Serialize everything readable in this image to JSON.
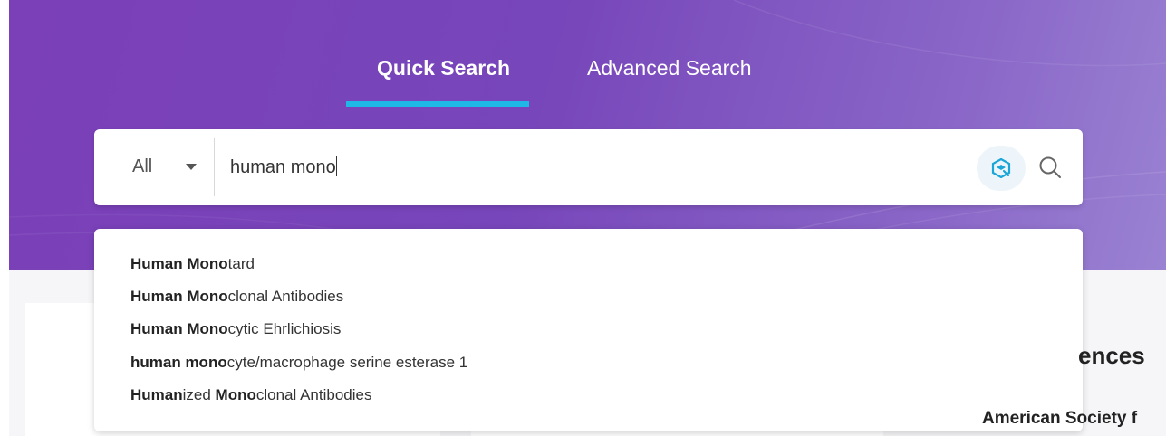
{
  "tabs": [
    {
      "label": "Quick Search",
      "active": true
    },
    {
      "label": "Advanced Search",
      "active": false
    }
  ],
  "search": {
    "scope": "All",
    "query": "human mono"
  },
  "suggestions": [
    {
      "bold": "Human Mono",
      "rest": "tard"
    },
    {
      "bold": "Human Mono",
      "rest": "clonal Antibodies"
    },
    {
      "bold": "Human Mono",
      "rest": "cytic Ehrlichiosis"
    },
    {
      "bold": "human mono",
      "rest": "cyte/macrophage serine esterase 1"
    },
    {
      "parts": [
        {
          "b": "Human"
        },
        {
          "t": "ized "
        },
        {
          "b": "Mono"
        },
        {
          "t": "clonal Antibodies"
        }
      ]
    }
  ],
  "background": {
    "heading_fragment": "ences",
    "sub_fragment": "American Society f"
  },
  "colors": {
    "hero_purple": "#7b3fb8",
    "tab_underline": "#1fb8e6",
    "ai_icon": "#1aa6d6"
  },
  "icons": {
    "scope_caret": "chevron-down-icon",
    "ai": "ai-assist-icon",
    "search": "search-icon"
  }
}
